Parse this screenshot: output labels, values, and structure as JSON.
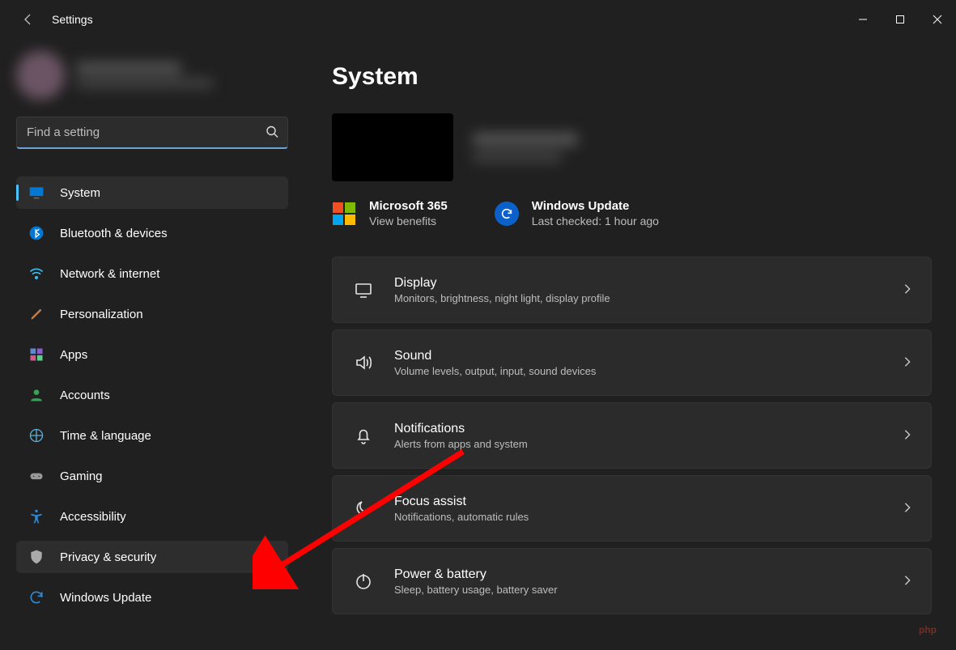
{
  "app": {
    "title": "Settings"
  },
  "search": {
    "placeholder": "Find a setting"
  },
  "sidebar": {
    "items": [
      {
        "label": "System"
      },
      {
        "label": "Bluetooth & devices"
      },
      {
        "label": "Network & internet"
      },
      {
        "label": "Personalization"
      },
      {
        "label": "Apps"
      },
      {
        "label": "Accounts"
      },
      {
        "label": "Time & language"
      },
      {
        "label": "Gaming"
      },
      {
        "label": "Accessibility"
      },
      {
        "label": "Privacy & security"
      },
      {
        "label": "Windows Update"
      }
    ]
  },
  "main": {
    "title": "System",
    "promos": {
      "m365": {
        "title": "Microsoft 365",
        "sub": "View benefits"
      },
      "wu": {
        "title": "Windows Update",
        "sub": "Last checked: 1 hour ago"
      }
    },
    "cards": [
      {
        "title": "Display",
        "sub": "Monitors, brightness, night light, display profile"
      },
      {
        "title": "Sound",
        "sub": "Volume levels, output, input, sound devices"
      },
      {
        "title": "Notifications",
        "sub": "Alerts from apps and system"
      },
      {
        "title": "Focus assist",
        "sub": "Notifications, automatic rules"
      },
      {
        "title": "Power & battery",
        "sub": "Sleep, battery usage, battery saver"
      }
    ]
  },
  "watermark": "php"
}
